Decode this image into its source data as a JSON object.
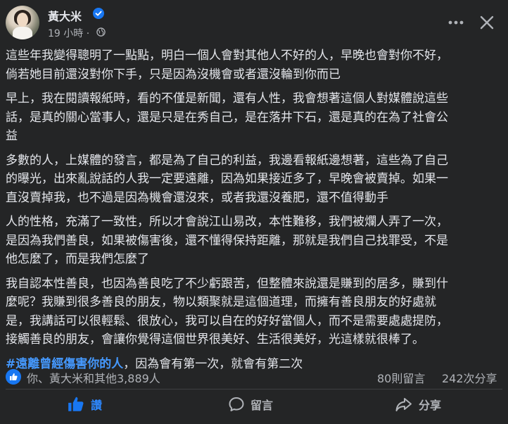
{
  "author": {
    "name": "黃大米",
    "time": "19 小時",
    "separator": "·"
  },
  "post": {
    "paragraphs": [
      "這些年我變得聰明了一點點，明白一個人會對其他人不好的人，早晚也會對你不好，\n倘若她目前還沒對你下手，只是因為沒機會或者還沒輪到你而已",
      "早上，我在閱讀報紙時，看的不僅是新聞，還有人性，我會想著這個人對媒體說這些\n話，是真的關心當事人，還是只是在秀自己，是在落井下石，還是真的在為了社會公\n益",
      "多數的人，上媒體的發言，都是為了自己的利益，我邊看報紙邊想著，這些為了自己\n的曝光，出來亂說話的人我一定要遠離，因為如果接近多了，早晚會被賣掉。如果一\n直沒賣掉我，也不過是因為機會還沒來，或者我還沒養肥，還不值得動手",
      "人的性格，充滿了一致性，所以才會說江山易改，本性難移，我們被爛人弄了一次，\n是因為我們善良，如果被傷害後，還不懂得保持距離，那就是我們自己找罪受，不是\n他怎麼了，而是我們怎麼了",
      "我自認本性善良，也因為善良吃了不少虧跟苦，但整體來說還是賺到的居多，賺到什\n麼呢？我賺到很多善良的朋友，物以類聚就是這個道理，而擁有善良朋友的好處就\n是，我講話可以很輕鬆、很放心，我可以自在的好好當個人，而不是需要處處提防，\n接觸善良的朋友，會讓你覺得這個世界很美好、生活很美好，光這樣就很棒了。"
    ],
    "hashtag": "#遠離曾經傷害你的人",
    "hashtag_tail": "，因為會有第一次，就會有第二次"
  },
  "stats": {
    "reactions": "你、黃大米和其他3,889人",
    "comments": "80則留言",
    "shares": "242次分享"
  },
  "actions": {
    "like": "讚",
    "comment": "留言",
    "share": "分享"
  },
  "colors": {
    "background": "#242526",
    "text": "#e4e6eb",
    "muted": "#b0b3b8",
    "like_blue": "#1877f2",
    "hashtag": "#4599ff"
  }
}
